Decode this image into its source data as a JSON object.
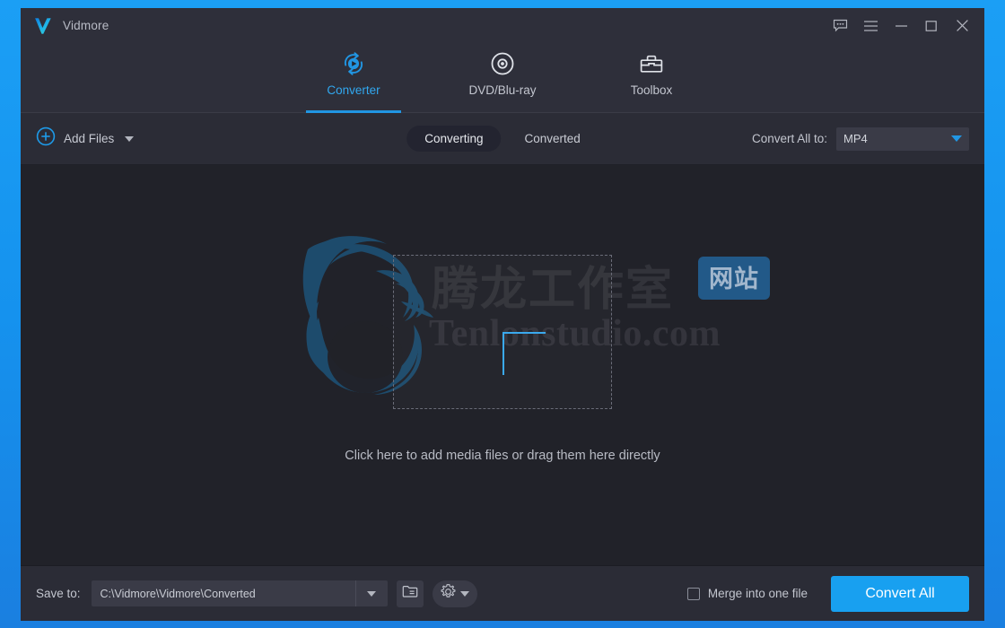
{
  "window": {
    "app_title": "Vidmore",
    "logo_icon": "vidmore-check-logo",
    "controls": [
      {
        "name": "feedback-button",
        "icon": "speech-bubble-icon"
      },
      {
        "name": "menu-button",
        "icon": "hamburger-menu-icon"
      },
      {
        "name": "minimize-button",
        "icon": "minimize-icon"
      },
      {
        "name": "maximize-button",
        "icon": "maximize-icon"
      },
      {
        "name": "close-button",
        "icon": "close-icon"
      }
    ]
  },
  "nav": {
    "tabs": [
      {
        "label": "Converter",
        "icon": "convert-refresh-play-icon",
        "active": true
      },
      {
        "label": "DVD/Blu-ray",
        "icon": "disc-icon",
        "active": false
      },
      {
        "label": "Toolbox",
        "icon": "toolbox-icon",
        "active": false
      }
    ]
  },
  "toolbar": {
    "add_files_label": "Add Files",
    "add_files_icon": "circle-plus-icon",
    "add_files_caret": "chevron-down-icon",
    "segments": [
      {
        "label": "Converting",
        "active": true
      },
      {
        "label": "Converted",
        "active": false
      }
    ],
    "convert_all_to_label": "Convert All to:",
    "format_value": "MP4",
    "format_caret": "chevron-down-icon"
  },
  "content": {
    "dropzone_icon": "plus-icon",
    "hint": "Click here to add media files or drag them here directly",
    "watermark": {
      "logo_icon": "dragon-ring-logo",
      "chinese_text": "腾龙工作室",
      "badge_text": "网站",
      "site_text": "Tenlonstudio.com"
    }
  },
  "bottom": {
    "save_to_label": "Save to:",
    "save_path": "C:\\Vidmore\\Vidmore\\Converted",
    "path_caret": "chevron-down-icon",
    "folder_icon": "folder-icon",
    "gear_icon": "gear-icon",
    "gear_caret": "chevron-down-icon",
    "merge_label": "Merge into one file",
    "merge_checked": false,
    "convert_all_label": "Convert All"
  },
  "colors": {
    "window_border": "#18a0fb",
    "accent": "#2196e3",
    "primary_button": "#18a0f0",
    "titlebar_bg": "#2e2f3a",
    "content_bg": "#212229",
    "bottombar_bg": "#2b2c36"
  }
}
